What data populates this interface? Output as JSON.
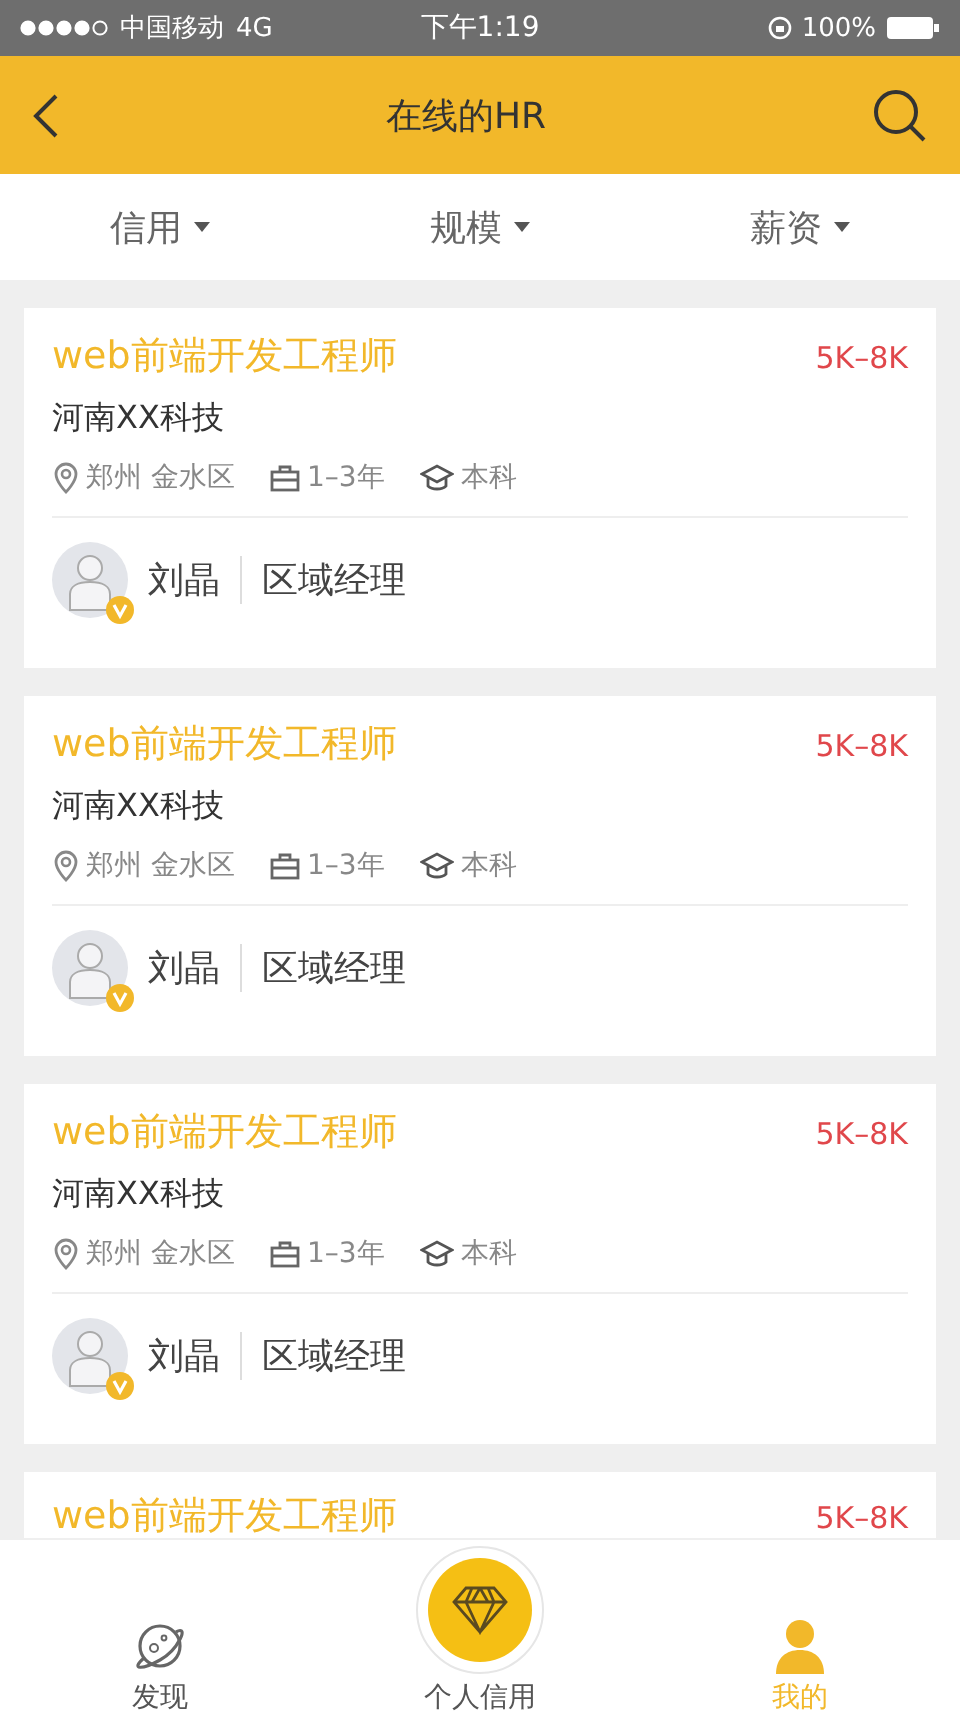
{
  "status_bar": {
    "carrier": "中国移动",
    "network": "4G",
    "time": "下午1:19",
    "battery": "100%"
  },
  "header": {
    "title": "在线的HR"
  },
  "filters": [
    {
      "label": "信用"
    },
    {
      "label": "规模"
    },
    {
      "label": "薪资"
    }
  ],
  "jobs": [
    {
      "title": "web前端开发工程师",
      "salary": "5K–8K",
      "company": "河南XX科技",
      "location": "郑州 金水区",
      "experience": "1–3年",
      "education": "本科",
      "recruiter": "刘晶",
      "role": "区域经理",
      "verified": true
    },
    {
      "title": "web前端开发工程师",
      "salary": "5K–8K",
      "company": "河南XX科技",
      "location": "郑州 金水区",
      "experience": "1–3年",
      "education": "本科",
      "recruiter": "刘晶",
      "role": "区域经理",
      "verified": true
    },
    {
      "title": "web前端开发工程师",
      "salary": "5K–8K",
      "company": "河南XX科技",
      "location": "郑州 金水区",
      "experience": "1–3年",
      "education": "本科",
      "recruiter": "刘晶",
      "role": "区域经理",
      "verified": true
    },
    {
      "title": "web前端开发工程师",
      "salary": "5K–8K"
    }
  ],
  "tab_bar": [
    {
      "label": "发现",
      "kind": "planet",
      "selected": false
    },
    {
      "label": "个人信用",
      "kind": "raised",
      "selected": false
    },
    {
      "label": "我的",
      "kind": "person",
      "selected": true
    }
  ]
}
